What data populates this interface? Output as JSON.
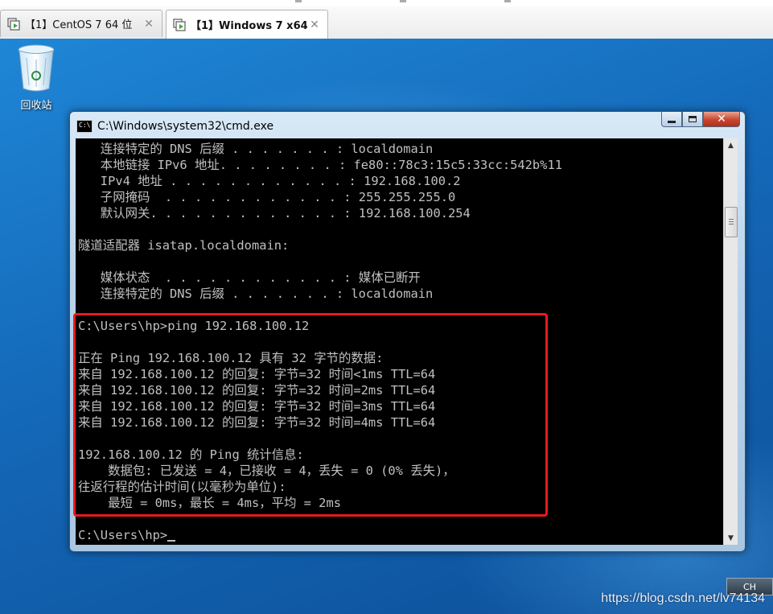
{
  "tabs": [
    {
      "label": "【1】CentOS 7 64 位",
      "active": false
    },
    {
      "label": "【1】Windows 7 x64",
      "active": true
    }
  ],
  "desktop": {
    "recycle_bin_label": "回收站"
  },
  "window": {
    "title": "C:\\Windows\\system32\\cmd.exe",
    "icon_text": "C:\\",
    "close_glyph": "✕"
  },
  "console": {
    "lines": [
      "   连接特定的 DNS 后缀 . . . . . . . : localdomain",
      "   本地链接 IPv6 地址. . . . . . . . : fe80::78c3:15c5:33cc:542b%11",
      "   IPv4 地址 . . . . . . . . . . . . : 192.168.100.2",
      "   子网掩码  . . . . . . . . . . . . : 255.255.255.0",
      "   默认网关. . . . . . . . . . . . . : 192.168.100.254",
      "",
      "隧道适配器 isatap.localdomain:",
      "",
      "   媒体状态  . . . . . . . . . . . . : 媒体已断开",
      "   连接特定的 DNS 后缀 . . . . . . . : localdomain",
      "",
      "C:\\Users\\hp>ping 192.168.100.12",
      "",
      "正在 Ping 192.168.100.12 具有 32 字节的数据:",
      "来自 192.168.100.12 的回复: 字节=32 时间<1ms TTL=64",
      "来自 192.168.100.12 的回复: 字节=32 时间=2ms TTL=64",
      "来自 192.168.100.12 的回复: 字节=32 时间=3ms TTL=64",
      "来自 192.168.100.12 的回复: 字节=32 时间=4ms TTL=64",
      "",
      "192.168.100.12 的 Ping 统计信息:",
      "    数据包: 已发送 = 4，已接收 = 4，丢失 = 0 (0% 丢失)，",
      "往返行程的估计时间(以毫秒为单位):",
      "    最短 = 0ms，最长 = 4ms，平均 = 2ms",
      "",
      "C:\\Users\\hp>"
    ]
  },
  "tray": {
    "lang": "CH"
  },
  "watermark": "https://blog.csdn.net/lv74134",
  "colors": {
    "highlight_border": "#e8191c",
    "console_bg": "#000000",
    "console_fg": "#c0c0c0"
  }
}
